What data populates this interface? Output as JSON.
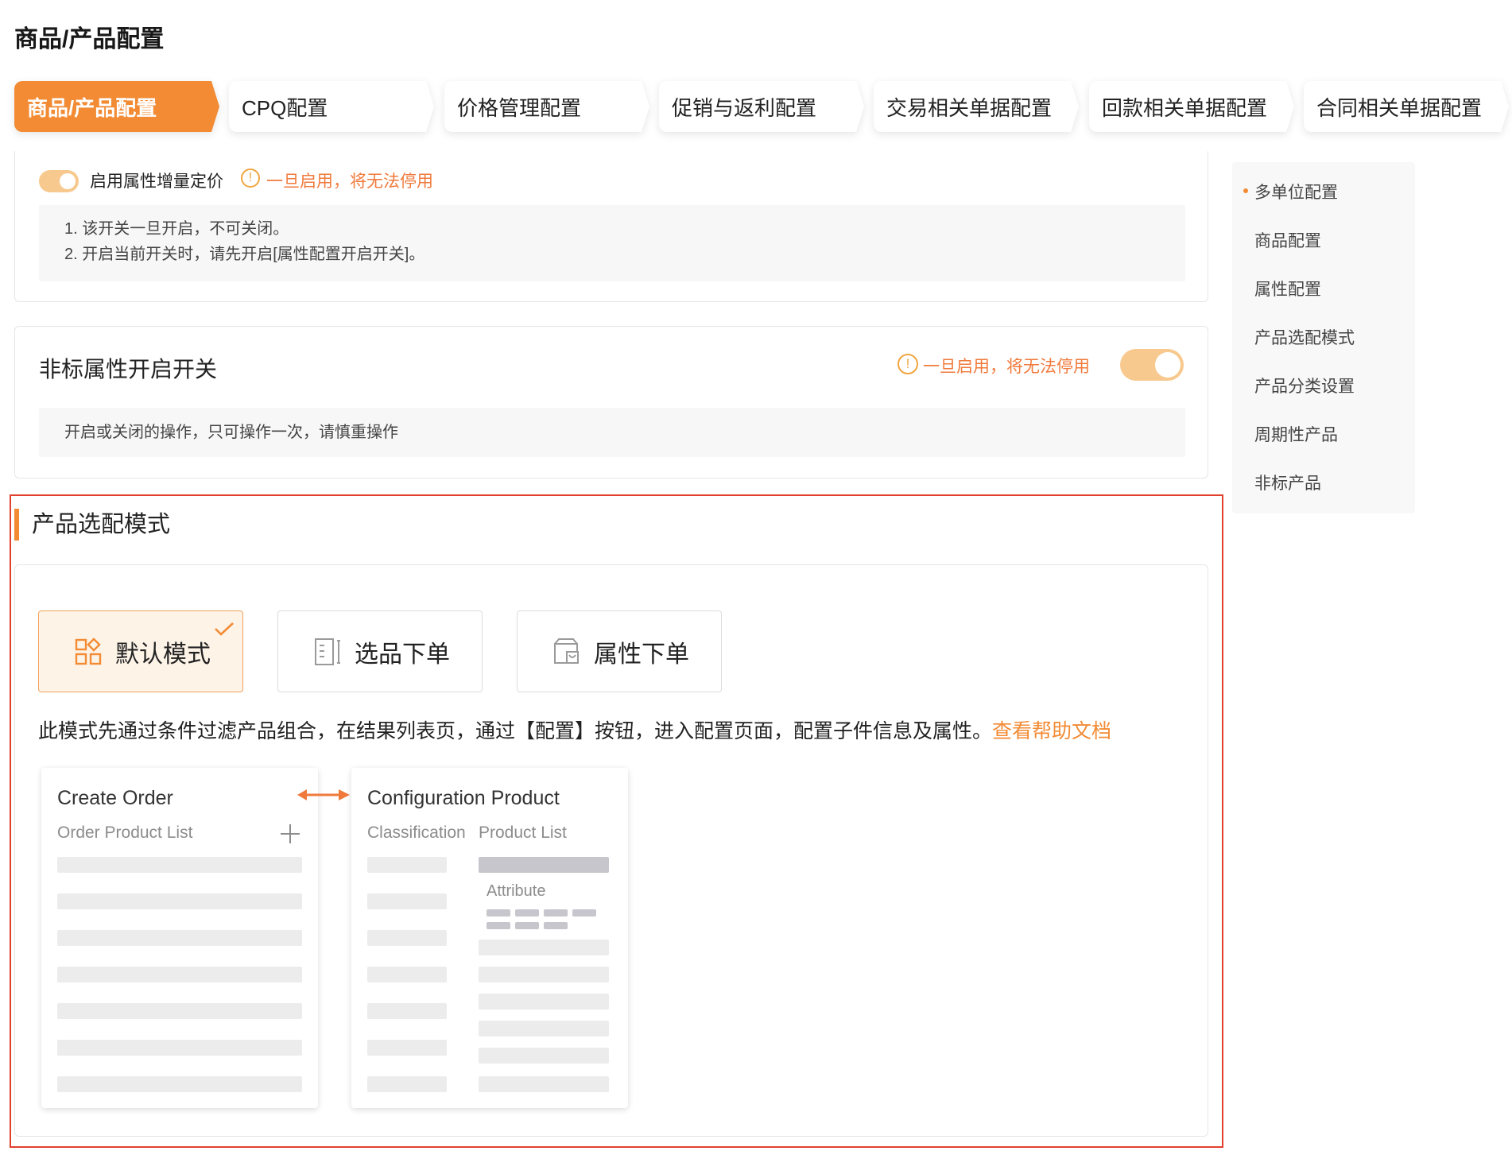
{
  "page": {
    "title": "商品/产品配置"
  },
  "tabs": [
    {
      "label": "商品/产品配置",
      "active": true
    },
    {
      "label": "CPQ配置",
      "active": false
    },
    {
      "label": "价格管理配置",
      "active": false
    },
    {
      "label": "促销与返利配置",
      "active": false
    },
    {
      "label": "交易相关单据配置",
      "active": false
    },
    {
      "label": "回款相关单据配置",
      "active": false
    },
    {
      "label": "合同相关单据配置",
      "active": false
    }
  ],
  "attr_pricing": {
    "toggle_label": "启用属性增量定价",
    "toggle_on": true,
    "warning": "一旦启用，将无法停用",
    "hints": [
      "1. 该开关一旦开启，不可关闭。",
      "2. 开启当前开关时，请先开启[属性配置开启开关]。"
    ]
  },
  "nonstd_attr": {
    "title": "非标属性开启开关",
    "warning": "一旦启用，将无法停用",
    "toggle_on": true,
    "hint": "开启或关闭的操作，只可操作一次，请慎重操作"
  },
  "side_nav": {
    "items": [
      {
        "label": "多单位配置",
        "active": true
      },
      {
        "label": "商品配置",
        "active": false
      },
      {
        "label": "属性配置",
        "active": false
      },
      {
        "label": "产品选配模式",
        "active": false
      },
      {
        "label": "产品分类设置",
        "active": false
      },
      {
        "label": "周期性产品",
        "active": false
      },
      {
        "label": "非标产品",
        "active": false
      }
    ]
  },
  "selection_mode": {
    "title": "产品选配模式",
    "options": [
      {
        "label": "默认模式",
        "icon": "grid-icon",
        "selected": true
      },
      {
        "label": "选品下单",
        "icon": "list-icon",
        "selected": false
      },
      {
        "label": "属性下单",
        "icon": "cart-icon",
        "selected": false
      }
    ],
    "description": "此模式先通过条件过滤产品组合，在结果列表页，通过【配置】按钮，进入配置页面，配置子件信息及属性。",
    "help_link": "查看帮助文档",
    "illustration": {
      "left": {
        "title": "Create Order",
        "subtitle": "Order Product List"
      },
      "right": {
        "title": "Configuration Product",
        "col1": "Classification",
        "col2": "Product List",
        "attribute": "Attribute"
      }
    }
  },
  "colors": {
    "accent": "#f28b34",
    "warning": "#f07a3c",
    "toggle": "#f7c98e",
    "frame": "#e2402e"
  }
}
